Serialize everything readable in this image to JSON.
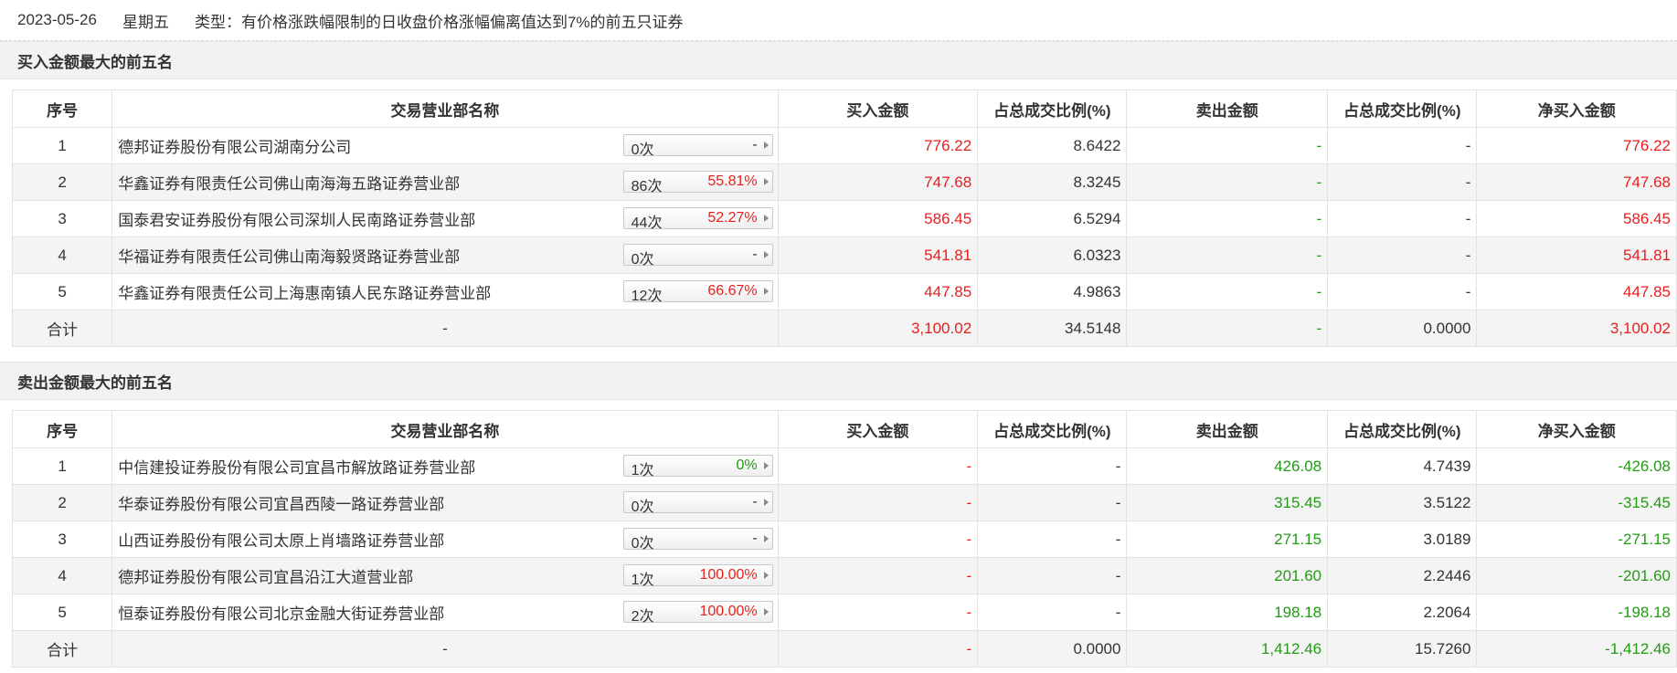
{
  "header": {
    "date": "2023-05-26",
    "weekday": "星期五",
    "type_label": "类型：有价格涨跌幅限制的日收盘价格涨幅偏离值达到7%的前五只证券"
  },
  "columns": [
    "序号",
    "交易营业部名称",
    "买入金额",
    "占总成交比例(%)",
    "卖出金额",
    "占总成交比例(%)",
    "净买入金额"
  ],
  "buy_section": {
    "title": "买入金额最大的前五名",
    "rows": [
      {
        "idx": "1",
        "name": "德邦证券股份有限公司湖南分公司",
        "count": "0次",
        "pct": "-",
        "pct_color": "dark",
        "buy": "776.22",
        "buy_ratio": "8.6422",
        "sell": "-",
        "sell_ratio": "-",
        "net": "776.22"
      },
      {
        "idx": "2",
        "name": "华鑫证券有限责任公司佛山南海海五路证券营业部",
        "count": "86次",
        "pct": "55.81%",
        "pct_color": "red",
        "buy": "747.68",
        "buy_ratio": "8.3245",
        "sell": "-",
        "sell_ratio": "-",
        "net": "747.68"
      },
      {
        "idx": "3",
        "name": "国泰君安证券股份有限公司深圳人民南路证券营业部",
        "count": "44次",
        "pct": "52.27%",
        "pct_color": "red",
        "buy": "586.45",
        "buy_ratio": "6.5294",
        "sell": "-",
        "sell_ratio": "-",
        "net": "586.45"
      },
      {
        "idx": "4",
        "name": "华福证券有限责任公司佛山南海毅贤路证券营业部",
        "count": "0次",
        "pct": "-",
        "pct_color": "dark",
        "buy": "541.81",
        "buy_ratio": "6.0323",
        "sell": "-",
        "sell_ratio": "-",
        "net": "541.81"
      },
      {
        "idx": "5",
        "name": "华鑫证券有限责任公司上海惠南镇人民东路证券营业部",
        "count": "12次",
        "pct": "66.67%",
        "pct_color": "red",
        "buy": "447.85",
        "buy_ratio": "4.9863",
        "sell": "-",
        "sell_ratio": "-",
        "net": "447.85"
      }
    ],
    "total": {
      "label": "合计",
      "name": "-",
      "buy": "3,100.02",
      "buy_ratio": "34.5148",
      "sell": "-",
      "sell_ratio": "0.0000",
      "net": "3,100.02"
    }
  },
  "sell_section": {
    "title": "卖出金额最大的前五名",
    "rows": [
      {
        "idx": "1",
        "name": "中信建投证券股份有限公司宜昌市解放路证券营业部",
        "count": "1次",
        "pct": "0%",
        "pct_color": "green",
        "buy": "-",
        "buy_ratio": "-",
        "sell": "426.08",
        "sell_ratio": "4.7439",
        "net": "-426.08"
      },
      {
        "idx": "2",
        "name": "华泰证券股份有限公司宜昌西陵一路证券营业部",
        "count": "0次",
        "pct": "-",
        "pct_color": "dark",
        "buy": "-",
        "buy_ratio": "-",
        "sell": "315.45",
        "sell_ratio": "3.5122",
        "net": "-315.45"
      },
      {
        "idx": "3",
        "name": "山西证券股份有限公司太原上肖墙路证券营业部",
        "count": "0次",
        "pct": "-",
        "pct_color": "dark",
        "buy": "-",
        "buy_ratio": "-",
        "sell": "271.15",
        "sell_ratio": "3.0189",
        "net": "-271.15"
      },
      {
        "idx": "4",
        "name": "德邦证券股份有限公司宜昌沿江大道营业部",
        "count": "1次",
        "pct": "100.00%",
        "pct_color": "red",
        "buy": "-",
        "buy_ratio": "-",
        "sell": "201.60",
        "sell_ratio": "2.2446",
        "net": "-201.60"
      },
      {
        "idx": "5",
        "name": "恒泰证券股份有限公司北京金融大街证券营业部",
        "count": "2次",
        "pct": "100.00%",
        "pct_color": "red",
        "buy": "-",
        "buy_ratio": "-",
        "sell": "198.18",
        "sell_ratio": "2.2064",
        "net": "-198.18"
      }
    ],
    "total": {
      "label": "合计",
      "name": "-",
      "buy": "-",
      "buy_ratio": "0.0000",
      "sell": "1,412.46",
      "sell_ratio": "15.7260",
      "net": "-1,412.46"
    }
  },
  "colors": {
    "red": "#e81e1e",
    "green": "#229a13",
    "dark": "#333333"
  }
}
